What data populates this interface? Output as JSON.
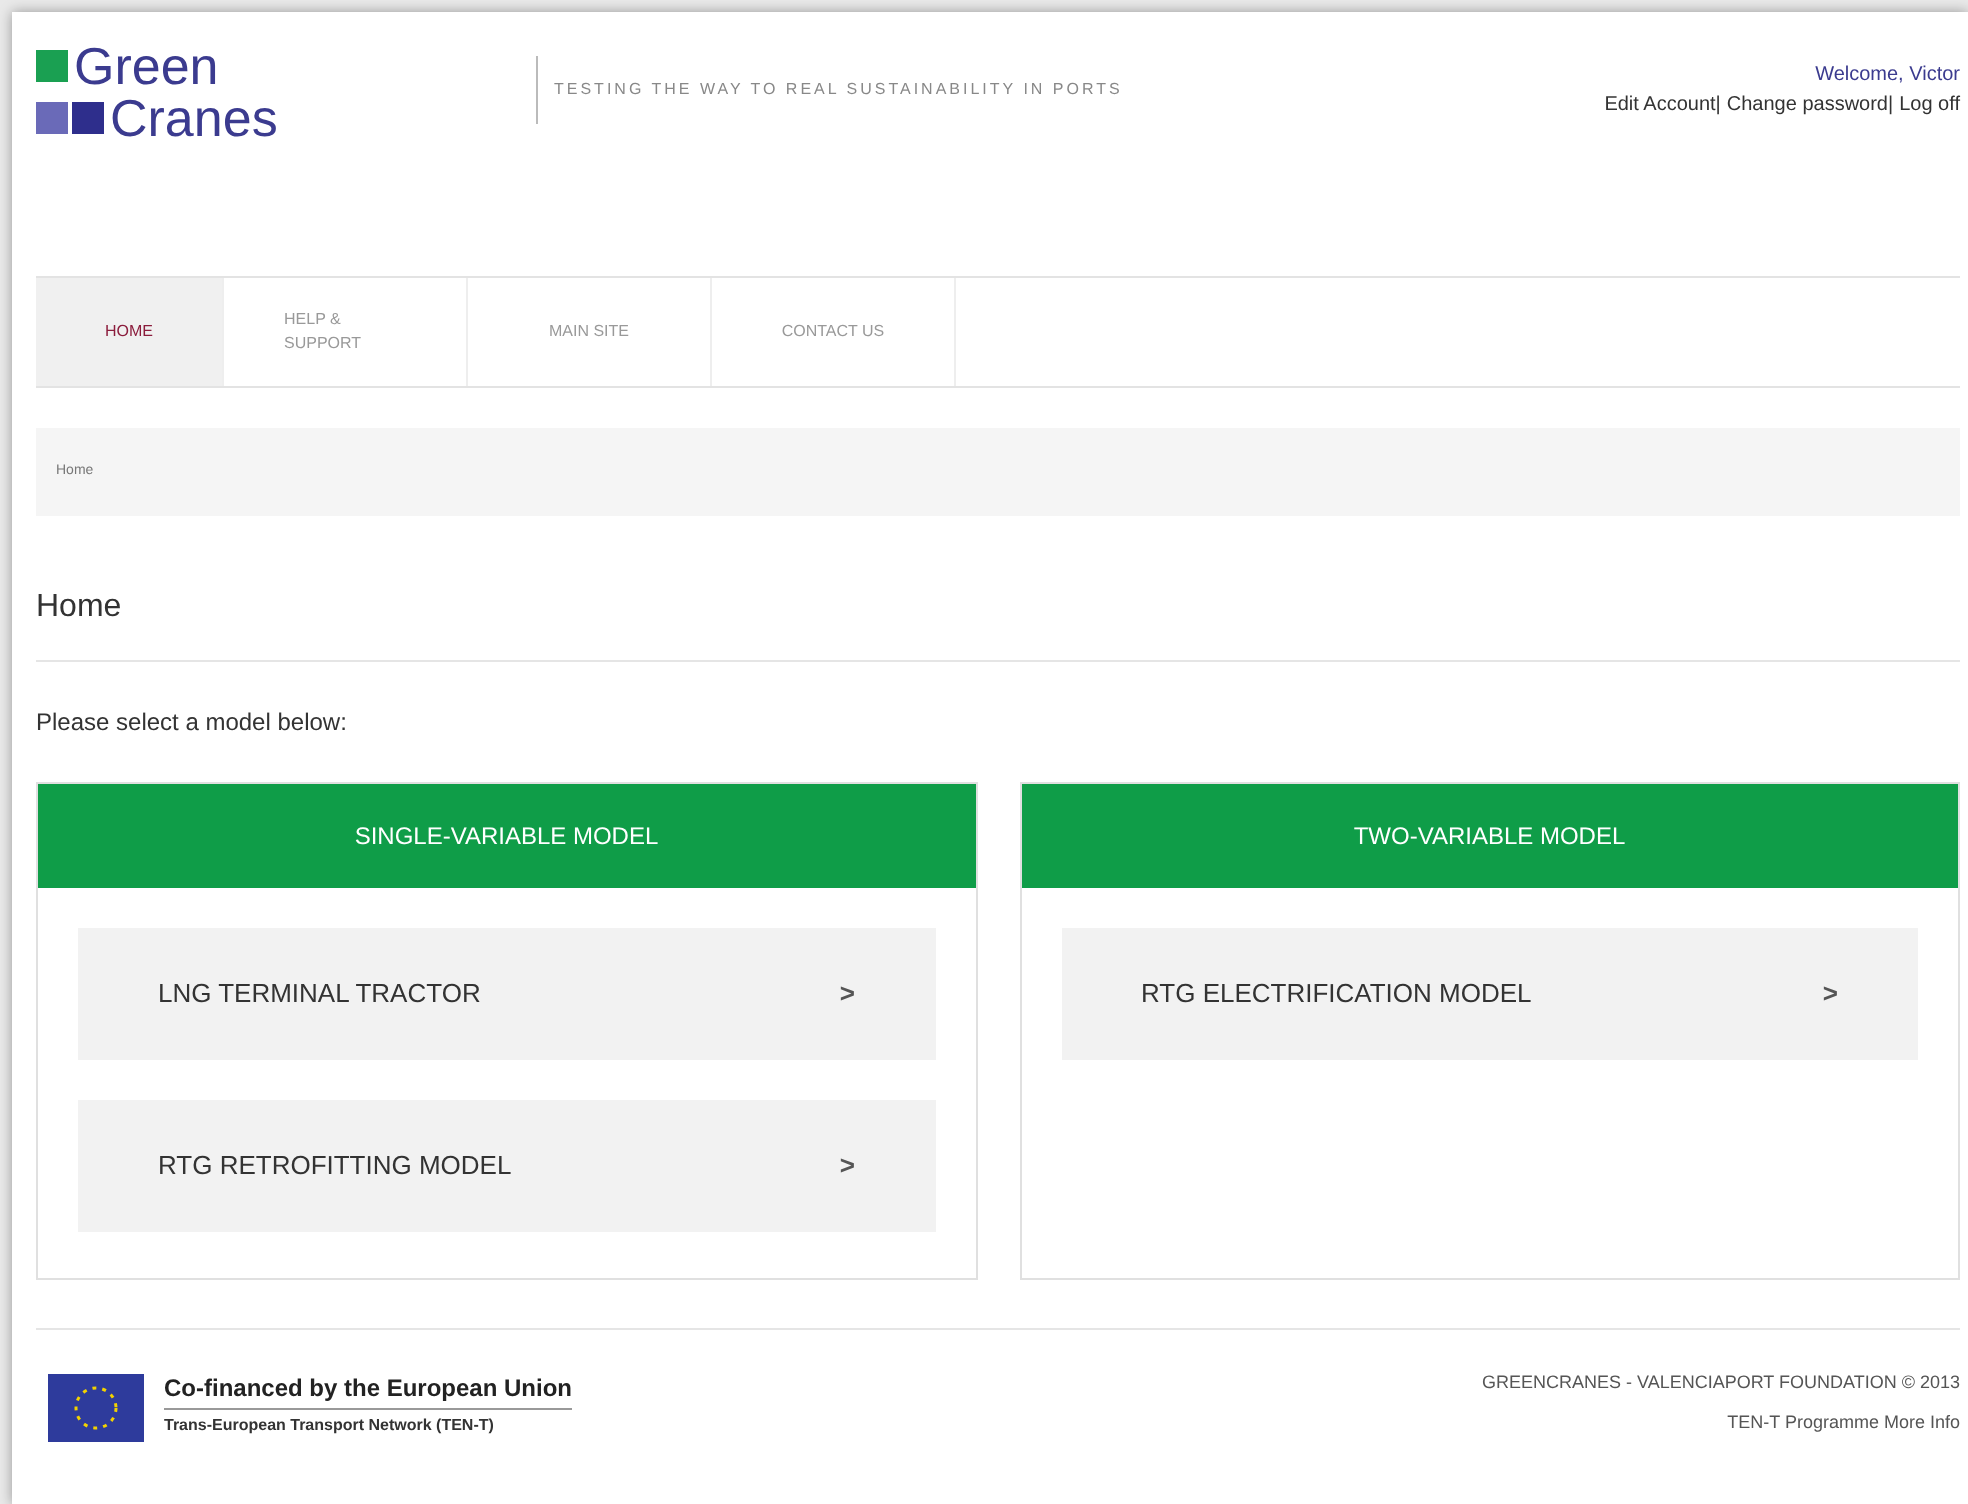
{
  "header": {
    "logo": {
      "line_1": "Green",
      "line_2": "Cranes"
    },
    "tagline": "TESTING THE WAY TO REAL SUSTAINABILITY IN PORTS",
    "welcome": "Welcome, Victor",
    "account_links": [
      "Edit Account|",
      "Change password|",
      "Log off"
    ]
  },
  "nav": [
    {
      "label": "HOME",
      "selected": true
    },
    {
      "label": "HELP & SUPPORT",
      "selected": false
    },
    {
      "label": "MAIN SITE",
      "selected": false
    },
    {
      "label": "CONTACT US",
      "selected": false
    }
  ],
  "breadcrumb": "Home",
  "page_title": "Home",
  "intro": "Please select a model below:",
  "panels": [
    {
      "title": "SINGLE-VARIABLE MODEL",
      "items": [
        {
          "label": "LNG TERMINAL TRACTOR",
          "arrow": ">"
        },
        {
          "label": "RTG RETROFITTING MODEL",
          "arrow": ">"
        }
      ]
    },
    {
      "title": "TWO-VARIABLE MODEL",
      "items": [
        {
          "label": "RTG ELECTRIFICATION MODEL",
          "arrow": ">"
        }
      ]
    }
  ],
  "footer": {
    "funding_title": "Co-financed by the European Union",
    "funding_subtitle": "Trans-European Transport Network (TEN-T)",
    "copyright": "GREENCRANES - VALENCIAPORT FOUNDATION © 2013",
    "more_info": "TEN-T Programme More Info"
  }
}
